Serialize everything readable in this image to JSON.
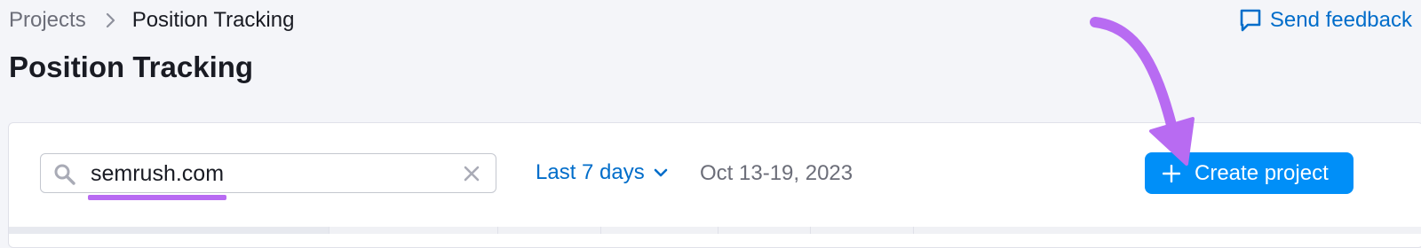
{
  "breadcrumb": {
    "parent": "Projects",
    "current": "Position Tracking"
  },
  "page": {
    "title": "Position Tracking"
  },
  "feedback": {
    "label": "Send feedback",
    "icon": "feedback-chat-icon"
  },
  "search": {
    "value": "semrush.com",
    "icon": "search-icon",
    "clear_icon": "clear-icon"
  },
  "period": {
    "label": "Last 7 days",
    "icon": "chevron-down-icon"
  },
  "date_range": {
    "label": "Oct 13-19, 2023"
  },
  "toolbar": {
    "create_label": "Create project",
    "create_icon": "plus-icon"
  },
  "colors": {
    "background": "#f4f5f9",
    "link_blue": "#006dca",
    "primary_button": "#008ff8",
    "annotation_purple": "#b86bf2"
  }
}
